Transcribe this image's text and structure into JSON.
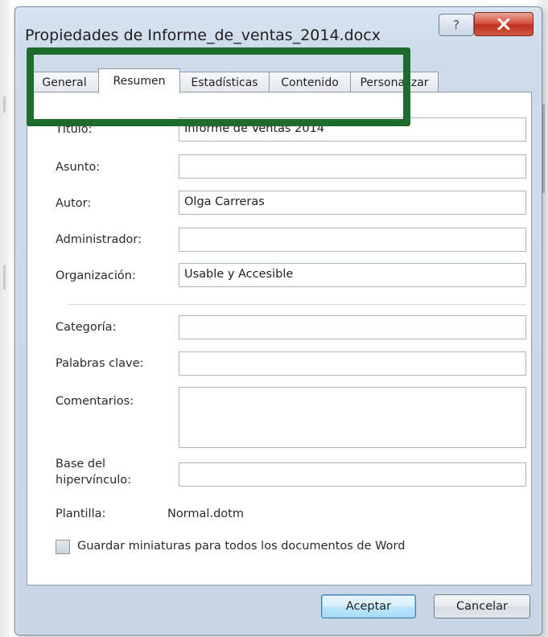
{
  "window": {
    "title": "Propiedades de Informe_de_ventas_2014.docx",
    "help_label": "?",
    "close_icon": "close-icon"
  },
  "tabs": [
    {
      "label": "General",
      "active": false
    },
    {
      "label": "Resumen",
      "active": true
    },
    {
      "label": "Estadísticas",
      "active": false
    },
    {
      "label": "Contenido",
      "active": false
    },
    {
      "label": "Personalizar",
      "active": false
    }
  ],
  "fields": {
    "titulo": {
      "label": "Título:",
      "value": "Informe de Ventas 2014"
    },
    "asunto": {
      "label": "Asunto:",
      "value": ""
    },
    "autor": {
      "label": "Autor:",
      "value": "Olga Carreras"
    },
    "administrador": {
      "label": "Administrador:",
      "value": ""
    },
    "organizacion": {
      "label": "Organización:",
      "value": "Usable y Accesible"
    },
    "categoria": {
      "label": "Categoría:",
      "value": ""
    },
    "palabras_clave": {
      "label": "Palabras clave:",
      "value": ""
    },
    "comentarios": {
      "label": "Comentarios:",
      "value": ""
    },
    "base_hipervinculo": {
      "label_line1": "Base del",
      "label_line2": "hipervínculo:",
      "value": ""
    },
    "plantilla": {
      "label": "Plantilla:",
      "value": "Normal.dotm"
    }
  },
  "checkbox": {
    "label": "Guardar miniaturas para todos los documentos de Word",
    "checked": false
  },
  "buttons": {
    "ok": "Aceptar",
    "cancel": "Cancelar"
  },
  "colors": {
    "highlight": "#1e6b2e",
    "close_button": "#c0311d"
  }
}
